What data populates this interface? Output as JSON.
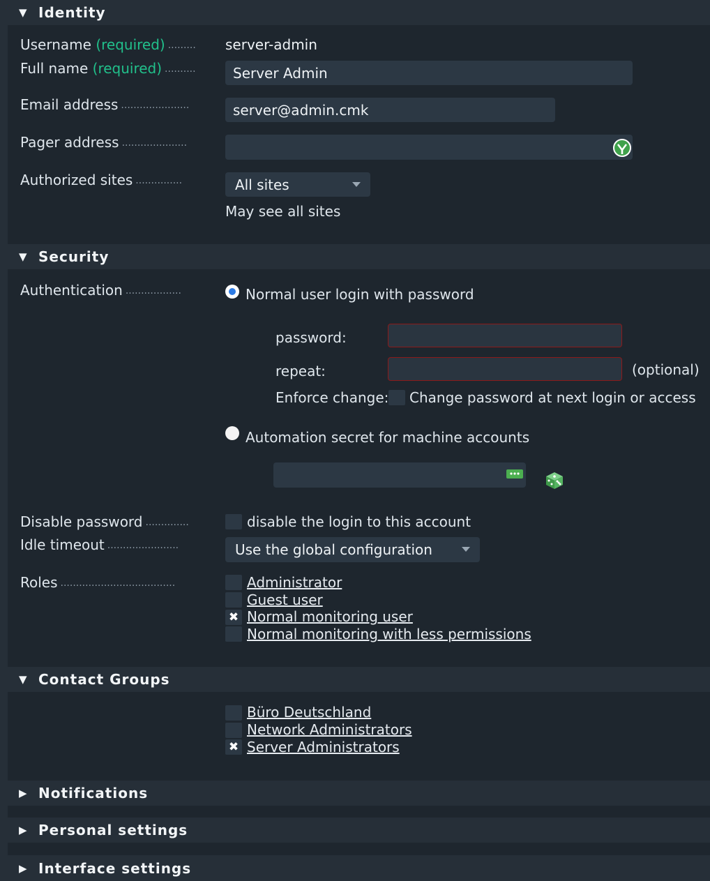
{
  "identity": {
    "header": "Identity",
    "username_label": "Username",
    "required": "(required)",
    "username_value": "server-admin",
    "fullname_label": "Full name",
    "fullname_value": "Server Admin",
    "email_label": "Email address",
    "email_value": "server@admin.cmk",
    "pager_label": "Pager address",
    "pager_value": "",
    "sites_label": "Authorized sites",
    "sites_value": "All sites",
    "sites_hint": "May see all sites"
  },
  "security": {
    "header": "Security",
    "auth_label": "Authentication",
    "option_password": "Normal user login with password",
    "password_label": "password:",
    "repeat_label": "repeat:",
    "optional": "(optional)",
    "enforce_label": "Enforce change:",
    "enforce_text": "Change password at next login or access",
    "option_secret": "Automation secret for machine accounts",
    "disable_label": "Disable password",
    "disable_text": "disable the login to this account",
    "idle_label": "Idle timeout",
    "idle_value": "Use the global configuration",
    "roles_label": "Roles",
    "roles": [
      {
        "label": "Administrator",
        "checked": false
      },
      {
        "label": "Guest user",
        "checked": false
      },
      {
        "label": "Normal monitoring user",
        "checked": true
      },
      {
        "label": "Normal monitoring with less permissions",
        "checked": false
      }
    ]
  },
  "contact_groups": {
    "header": "Contact Groups",
    "groups": [
      {
        "label": "Büro Deutschland",
        "checked": false
      },
      {
        "label": "Network Administrators",
        "checked": false
      },
      {
        "label": "Server Administrators",
        "checked": true
      }
    ]
  },
  "collapsed_sections": [
    "Notifications",
    "Personal settings",
    "Interface settings"
  ],
  "check_mark": "✖",
  "colors": {
    "accent_green": "#21c08b",
    "radio_blue": "#2c7be5",
    "error_border": "#8b1a1a"
  }
}
